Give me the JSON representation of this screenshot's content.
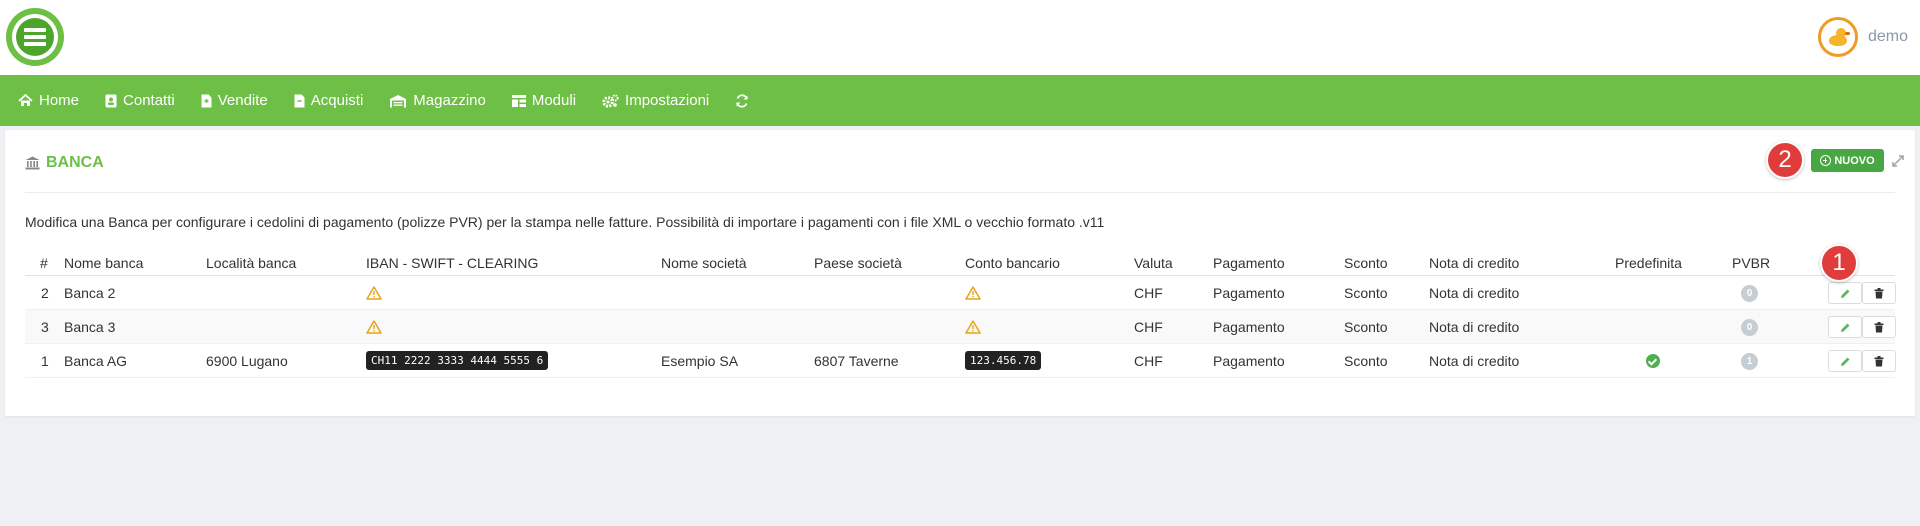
{
  "user": {
    "name": "demo"
  },
  "nav": {
    "items": [
      {
        "label": "Home",
        "icon": "home-icon"
      },
      {
        "label": "Contatti",
        "icon": "contacts-icon"
      },
      {
        "label": "Vendite",
        "icon": "document-icon"
      },
      {
        "label": "Acquisti",
        "icon": "document-icon"
      },
      {
        "label": "Magazzino",
        "icon": "warehouse-icon"
      },
      {
        "label": "Moduli",
        "icon": "modules-icon"
      },
      {
        "label": "Impostazioni",
        "icon": "gears-icon"
      }
    ]
  },
  "panel": {
    "title": "BANCA",
    "new_button": "NUOVO",
    "description": "Modifica una Banca per configurare i cedolini di pagamento (polizze PVR) per la stampa nelle fatture. Possibilità di importare i pagamenti con i file XML o vecchio formato .v11"
  },
  "badges": {
    "one": "1",
    "two": "2"
  },
  "table": {
    "headers": {
      "num": "#",
      "nome_banca": "Nome banca",
      "localita": "Località banca",
      "iban": "IBAN - SWIFT - CLEARING",
      "nome_societa": "Nome società",
      "paese_societa": "Paese società",
      "conto": "Conto bancario",
      "valuta": "Valuta",
      "pagamento": "Pagamento",
      "sconto": "Sconto",
      "nota": "Nota di credito",
      "predefinita": "Predefinita",
      "pvbr": "PVBR"
    },
    "rows": [
      {
        "num": "2",
        "nome_banca": "Banca 2",
        "localita": "",
        "iban": "",
        "nome_societa": "",
        "paese_societa": "",
        "conto": "",
        "valuta": "CHF",
        "pagamento": "Pagamento",
        "sconto": "Sconto",
        "nota": "Nota di credito",
        "pvbr": "0"
      },
      {
        "num": "3",
        "nome_banca": "Banca 3",
        "localita": "",
        "iban": "",
        "nome_societa": "",
        "paese_societa": "",
        "conto": "",
        "valuta": "CHF",
        "pagamento": "Pagamento",
        "sconto": "Sconto",
        "nota": "Nota di credito",
        "pvbr": "0"
      },
      {
        "num": "1",
        "nome_banca": "Banca AG",
        "localita": "6900 Lugano",
        "iban": "CH11 2222 3333 4444 5555 6",
        "nome_societa": "Esempio SA",
        "paese_societa": "6807 Taverne",
        "conto": "123.456.78",
        "valuta": "CHF",
        "pagamento": "Pagamento",
        "sconto": "Sconto",
        "nota": "Nota di credito",
        "pvbr": "1"
      }
    ]
  },
  "colors": {
    "brand_green": "#6dbf45",
    "button_green": "#48a742",
    "badge_red": "#e03c3c",
    "user_orange": "#f09b24"
  }
}
